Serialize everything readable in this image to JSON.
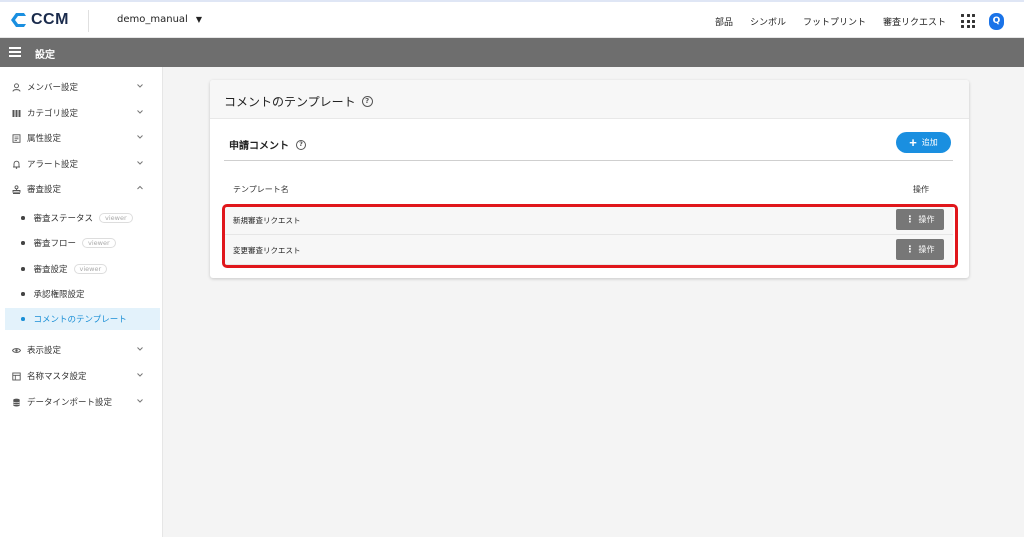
{
  "topbar": {
    "logo_text": "CCM",
    "project": "demo_manual",
    "nav": [
      "部品",
      "シンボル",
      "フットプリント",
      "審査リクエスト"
    ],
    "user_initial": "Q"
  },
  "header": {
    "title": "設定"
  },
  "sidebar": {
    "items": [
      {
        "label": "メンバー設定",
        "icon": "person-icon"
      },
      {
        "label": "カテゴリ設定",
        "icon": "category-icon"
      },
      {
        "label": "属性設定",
        "icon": "document-icon"
      },
      {
        "label": "アラート設定",
        "icon": "bell-icon"
      },
      {
        "label": "審査設定",
        "icon": "stamp-icon"
      }
    ],
    "sub_items": [
      {
        "label": "審査ステータス",
        "badge": "viewer"
      },
      {
        "label": "審査フロー",
        "badge": "viewer"
      },
      {
        "label": "審査設定",
        "badge": "viewer"
      },
      {
        "label": "承認権限設定",
        "badge": ""
      },
      {
        "label": "コメントのテンプレート",
        "badge": ""
      }
    ],
    "bottom_items": [
      {
        "label": "表示設定",
        "icon": "eye-icon"
      },
      {
        "label": "名称マスタ設定",
        "icon": "table-icon"
      },
      {
        "label": "データインポート設定",
        "icon": "database-icon"
      }
    ]
  },
  "main": {
    "card_title": "コメントのテンプレート",
    "section_title": "申請コメント",
    "add_label": "追加",
    "col_name": "テンプレート名",
    "col_op": "操作",
    "rows": [
      {
        "name": "新規審査リクエスト",
        "op_label": "操作"
      },
      {
        "name": "変更審査リクエスト",
        "op_label": "操作"
      }
    ]
  },
  "colors": {
    "accent": "#1a8fe0",
    "header_bar": "#6e6e6e",
    "highlight": "#e0161b",
    "active_bg": "#e3f2fb"
  }
}
